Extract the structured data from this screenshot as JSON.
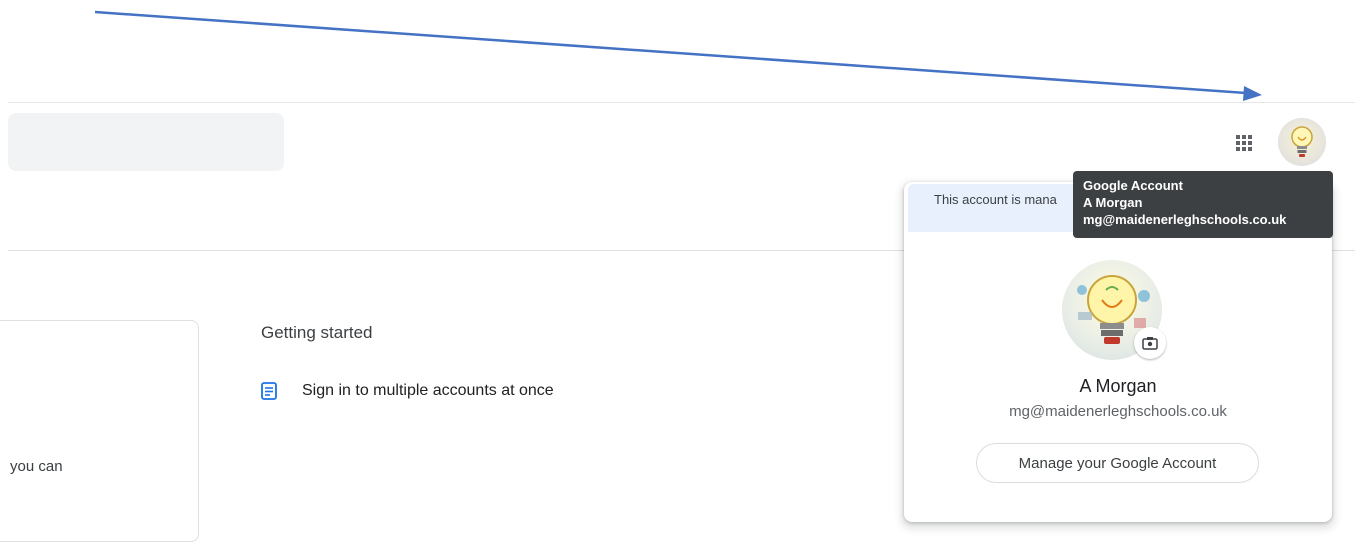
{
  "search": {
    "placeholder": ""
  },
  "header": {
    "apps_icon": "grid-icon",
    "avatar_icon": "lightbulb-icon"
  },
  "main": {
    "left_card_snippet": "you can",
    "getting_started": {
      "title": "Getting started",
      "items": [
        {
          "icon": "document-icon",
          "label": "Sign in to multiple accounts at once"
        }
      ]
    }
  },
  "account_popup": {
    "managed_banner": "This account is mana",
    "name": "A Morgan",
    "email": "mg@maidenerleghschools.co.uk",
    "manage_button": "Manage your Google Account",
    "camera_icon": "camera-icon"
  },
  "tooltip": {
    "title": "Google Account",
    "name": "A Morgan",
    "email": "mg@maidenerleghschools.co.uk"
  },
  "colors": {
    "arrow": "#4472c4",
    "banner": "#e8f0fe",
    "tooltip_bg": "#3c4043",
    "doc_icon": "#1a73e8"
  }
}
